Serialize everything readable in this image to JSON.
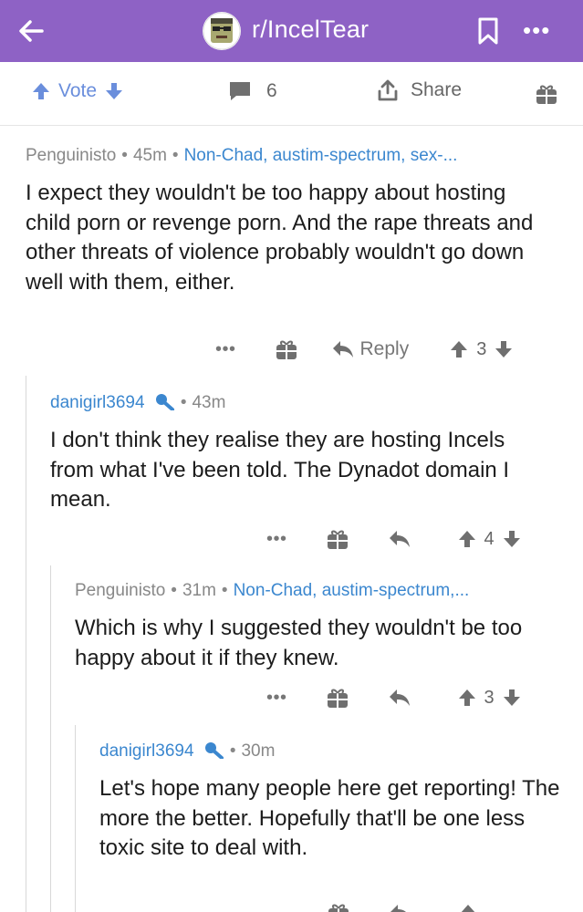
{
  "header": {
    "title": "r/IncelTear",
    "back_icon": "back-arrow-icon",
    "avatar_icon": "subreddit-avatar",
    "bookmark_icon": "bookmark-icon",
    "more_icon": "more-icon"
  },
  "actionbar": {
    "vote_label": "Vote",
    "comment_count": "6",
    "share_label": "Share"
  },
  "comments": [
    {
      "user": "Penguinisto",
      "time": "45m",
      "flair": "Non-Chad, austim-spectrum, sex-...",
      "body": "I expect they wouldn't be too happy about hosting child porn or revenge porn. And the rape threats and other threats of violence probably wouldn't go down well with them, either.",
      "reply_label": "Reply",
      "score": "3"
    },
    {
      "user": "danigirl3694",
      "time": "43m",
      "body": "I don't think they realise they are hosting Incels from what I've been told. The Dynadot domain I mean.",
      "score": "4"
    },
    {
      "user": "Penguinisto",
      "time": "31m",
      "flair": "Non-Chad, austim-spectrum,...",
      "body": "Which is why I suggested they wouldn't be too happy about it if they knew.",
      "score": "3"
    },
    {
      "user": "danigirl3694",
      "time": "30m",
      "body": "Let's hope many people here get reporting! The more the better. Hopefully that'll be one less toxic site to deal with."
    }
  ],
  "colors": {
    "header_bg": "#8e62c5",
    "vote_blue": "#6a8edc",
    "username_blue": "#3b87cf",
    "flair_blue": "#3b87cf"
  }
}
